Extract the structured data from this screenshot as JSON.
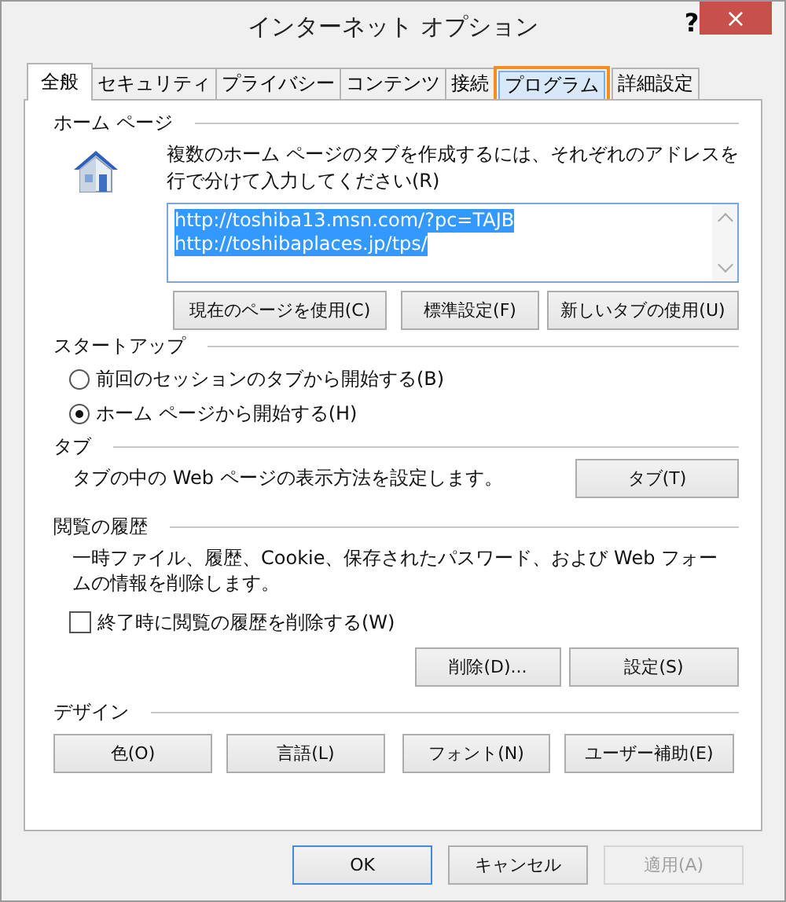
{
  "window": {
    "title": "インターネット オプション",
    "help": "?",
    "close": "×"
  },
  "tabs": [
    {
      "label": "全般",
      "selected": true,
      "highlighted": false
    },
    {
      "label": "セキュリティ",
      "selected": false,
      "highlighted": false
    },
    {
      "label": "プライバシー",
      "selected": false,
      "highlighted": false
    },
    {
      "label": "コンテンツ",
      "selected": false,
      "highlighted": false
    },
    {
      "label": "接続",
      "selected": false,
      "highlighted": false
    },
    {
      "label": "プログラム",
      "selected": false,
      "highlighted": true
    },
    {
      "label": "詳細設定",
      "selected": false,
      "highlighted": false
    }
  ],
  "home_page": {
    "heading": "ホーム ページ",
    "description": "複数のホーム ページのタブを作成するには、それぞれのアドレスを行で分けて入力してください(R)",
    "addresses": {
      "lines": [
        "http://toshiba13.msn.com/?pc=TAJB",
        "http://toshibaplaces.jp/tps/"
      ],
      "text_selected": true
    },
    "buttons": [
      "現在のページを使用(C)",
      "標準設定(F)",
      "新しいタブの使用(U)"
    ]
  },
  "startup": {
    "heading": "スタートアップ",
    "options": [
      {
        "label": "前回のセッションのタブから開始する(B)",
        "selected": false
      },
      {
        "label": "ホーム ページから開始する(H)",
        "selected": true
      }
    ]
  },
  "tabs_section": {
    "heading": "タブ",
    "description": "タブの中の Web ページの表示方法を設定します。",
    "button": "タブ(T)"
  },
  "history": {
    "heading": "閲覧の履歴",
    "description": "一時ファイル、履歴、Cookie、保存されたパスワード、および Web フォームの情報を削除します。",
    "checkbox": {
      "label": "終了時に閲覧の履歴を削除する(W)",
      "checked": false
    },
    "buttons": [
      "削除(D)...",
      "設定(S)"
    ]
  },
  "design": {
    "heading": "デザイン",
    "buttons": [
      "色(O)",
      "言語(L)",
      "フォント(N)",
      "ユーザー補助(E)"
    ]
  },
  "footer_buttons": [
    {
      "label": "OK",
      "default": true,
      "disabled": false
    },
    {
      "label": "キャンセル",
      "default": false,
      "disabled": false
    },
    {
      "label": "適用(A)",
      "default": false,
      "disabled": true
    }
  ]
}
